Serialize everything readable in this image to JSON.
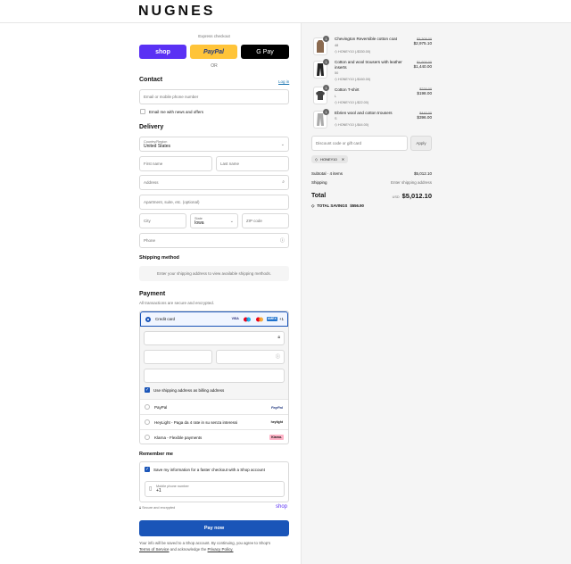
{
  "brand": "NUGNES",
  "express": {
    "label": "Express checkout",
    "shop": "shop",
    "paypal": "PayPal",
    "gpay": "G Pay",
    "or": "OR"
  },
  "contact": {
    "title": "Contact",
    "login": "Log in",
    "email_placeholder": "Email or mobile phone number",
    "newsletter": "Email me with news and offers"
  },
  "delivery": {
    "title": "Delivery",
    "country_label": "Country/Region",
    "country_value": "United States",
    "first_name": "First name",
    "last_name": "Last name",
    "address": "Address",
    "apartment": "Apartment, suite, etc. (optional)",
    "city": "City",
    "state_label": "State",
    "state_value": "Iowa",
    "zip": "ZIP code",
    "phone": "Phone"
  },
  "shipping": {
    "title": "Shipping method",
    "message": "Enter your shipping address to view available shipping methods."
  },
  "payment": {
    "title": "Payment",
    "subtitle": "All transactions are secure and encrypted.",
    "credit_card": "Credit card",
    "brands": [
      "VISA",
      "",
      "",
      "AMEX"
    ],
    "more": "+1",
    "billing_same": "Use shipping address as billing address",
    "paypal": "PayPal",
    "paypal_logo": "PayPal",
    "heylight": "HeyLight - Paga da 4 rate in su senza interessi",
    "heylight_logo": "heylight",
    "klarna": "Klarna - Flexible payments",
    "klarna_logo": "Klarna."
  },
  "remember": {
    "title": "Remember me",
    "save_info": "Save my information for a faster checkout with a Shop account",
    "mobile_label": "Mobile phone number",
    "mobile_value": "+1",
    "secure": "Secure and encrypted",
    "shop": "shop"
  },
  "pay_now": "Pay now",
  "footer": {
    "text1": "Your info will be saved to a Shop account. By continuing, you agree to Shop's",
    "terms": "Terms of Service",
    "and": "and acknowledge the",
    "privacy": "Privacy Policy."
  },
  "order": {
    "items": [
      {
        "qty": "1",
        "name": "Chevington Reversible cotton coat",
        "size": "48",
        "code": "HONEY10 (-$330.00)",
        "old": "$3,305.00",
        "price": "$2,975.10"
      },
      {
        "qty": "1",
        "name": "Cotton and wool trousers with leather inserts",
        "size": "50",
        "code": "HONEY10 (-$160.00)",
        "old": "$1,600.00",
        "price": "$1,440.00"
      },
      {
        "qty": "1",
        "name": "Cotton T-shirt",
        "size": "L",
        "code": "HONEY10 (-$22.00)",
        "old": "$220.00",
        "price": "$198.00"
      },
      {
        "qty": "1",
        "name": "Ebrien wool and cotton trousers",
        "size": "S",
        "code": "HONEY10 (-$44.00)",
        "old": "$440.00",
        "price": "$396.00"
      }
    ],
    "discount_placeholder": "Discount code or gift card",
    "apply": "Apply",
    "applied_code": "HONEY10",
    "subtotal_label": "Subtotal · 4 items",
    "subtotal_value": "$5,012.10",
    "shipping_label": "Shipping",
    "shipping_value": "Enter shipping address",
    "total_label": "Total",
    "currency": "USD",
    "total_value": "$5,012.10",
    "savings_label": "TOTAL SAVINGS",
    "savings_value": "$556.90"
  }
}
